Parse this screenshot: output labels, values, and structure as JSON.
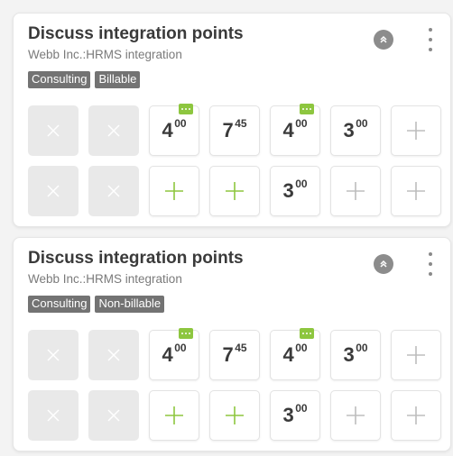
{
  "colors": {
    "accent_green": "#8dc63f",
    "plus_gray": "#bdbdbd",
    "x_white": "#ffffff",
    "tag_bg": "#737373"
  },
  "cards": [
    {
      "title": "Discuss integration points",
      "subtitle": "Webb Inc.:HRMS integration",
      "tags": [
        "Consulting",
        "Billable"
      ],
      "rows": [
        [
          {
            "type": "disabled"
          },
          {
            "type": "disabled"
          },
          {
            "type": "time",
            "h": "4",
            "m": "00",
            "comment": true
          },
          {
            "type": "time",
            "h": "7",
            "m": "45",
            "comment": false
          },
          {
            "type": "time",
            "h": "4",
            "m": "00",
            "comment": true
          },
          {
            "type": "time",
            "h": "3",
            "m": "00",
            "comment": false
          },
          {
            "type": "add",
            "color": "gray"
          }
        ],
        [
          {
            "type": "disabled"
          },
          {
            "type": "disabled"
          },
          {
            "type": "add",
            "color": "green"
          },
          {
            "type": "add",
            "color": "green"
          },
          {
            "type": "time",
            "h": "3",
            "m": "00",
            "comment": false
          },
          {
            "type": "add",
            "color": "gray"
          },
          {
            "type": "add",
            "color": "gray"
          }
        ]
      ]
    },
    {
      "title": "Discuss integration points",
      "subtitle": "Webb Inc.:HRMS integration",
      "tags": [
        "Consulting",
        "Non-billable"
      ],
      "rows": [
        [
          {
            "type": "disabled"
          },
          {
            "type": "disabled"
          },
          {
            "type": "time",
            "h": "4",
            "m": "00",
            "comment": true
          },
          {
            "type": "time",
            "h": "7",
            "m": "45",
            "comment": false
          },
          {
            "type": "time",
            "h": "4",
            "m": "00",
            "comment": true
          },
          {
            "type": "time",
            "h": "3",
            "m": "00",
            "comment": false
          },
          {
            "type": "add",
            "color": "gray"
          }
        ],
        [
          {
            "type": "disabled"
          },
          {
            "type": "disabled"
          },
          {
            "type": "add",
            "color": "green"
          },
          {
            "type": "add",
            "color": "green"
          },
          {
            "type": "time",
            "h": "3",
            "m": "00",
            "comment": false
          },
          {
            "type": "add",
            "color": "gray"
          },
          {
            "type": "add",
            "color": "gray"
          }
        ]
      ]
    }
  ]
}
